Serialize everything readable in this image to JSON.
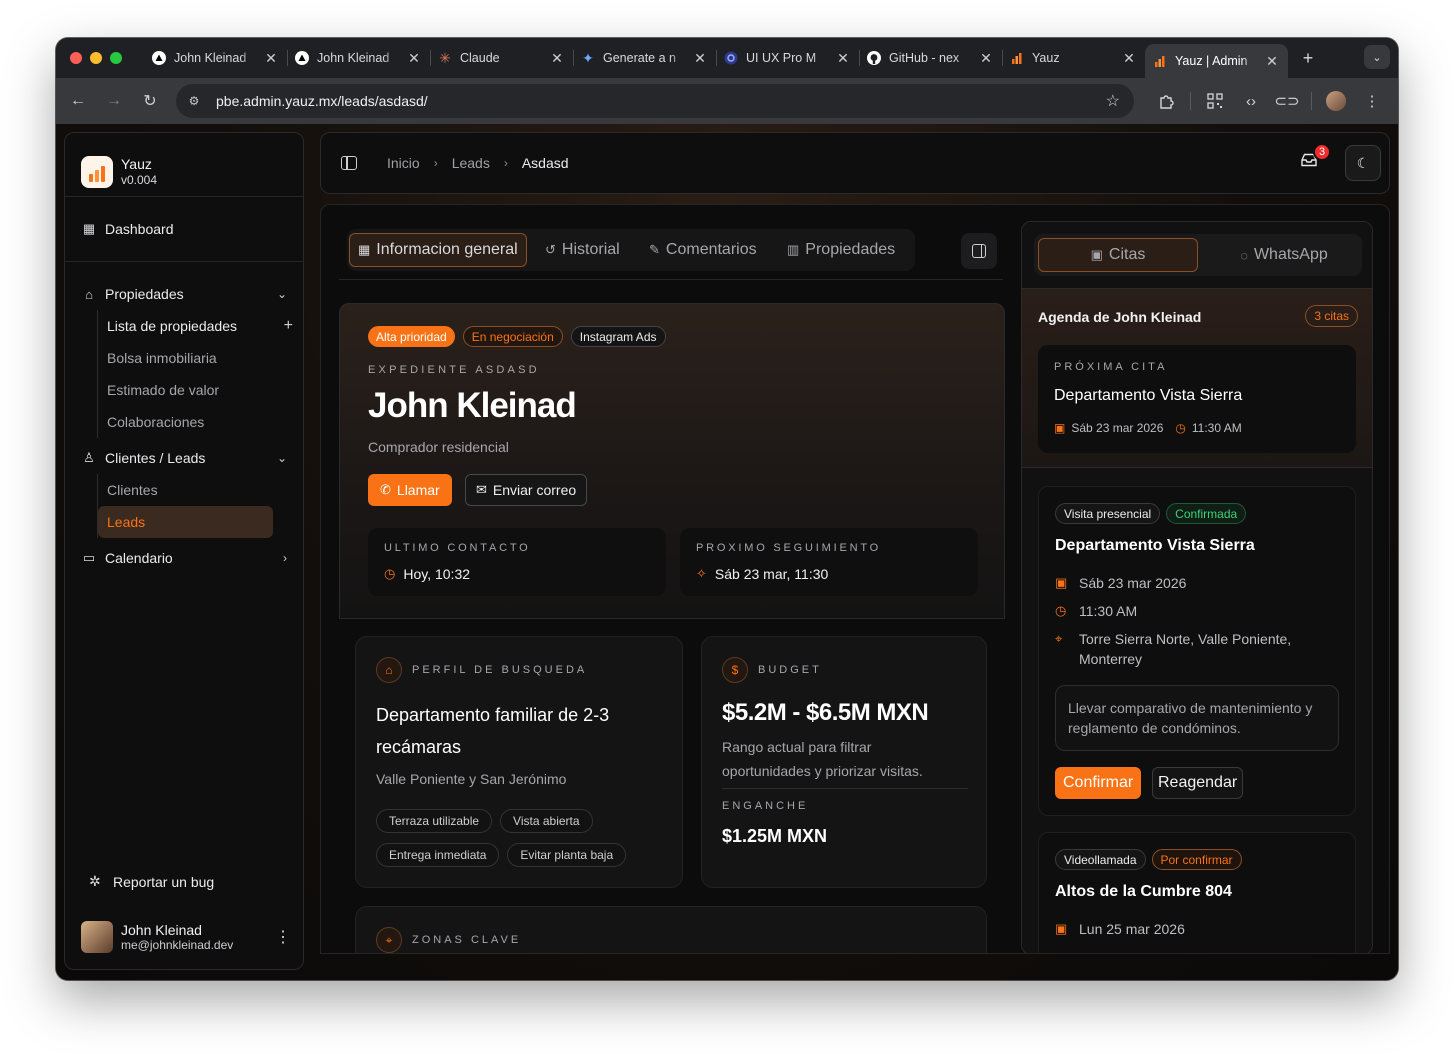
{
  "browser": {
    "tabs": [
      {
        "title": "John Kleinad",
        "icon": "triangle-icon"
      },
      {
        "title": "John Kleinad",
        "icon": "triangle-icon"
      },
      {
        "title": "Claude",
        "icon": "claude-icon"
      },
      {
        "title": "Generate a n",
        "icon": "sparkle-icon"
      },
      {
        "title": "UI UX Pro M",
        "icon": "circle-icon"
      },
      {
        "title": "GitHub - nex",
        "icon": "github-icon"
      },
      {
        "title": "Yauz",
        "icon": "yauz-icon"
      },
      {
        "title": "Yauz | Admin",
        "icon": "yauz-icon"
      }
    ],
    "url": "pbe.admin.yauz.mx/leads/asdasd/"
  },
  "brand": {
    "name": "Yauz",
    "version": "v0.004"
  },
  "sidebar": {
    "dashboard": "Dashboard",
    "propiedades": "Propiedades",
    "propiedades_items": [
      "Lista de propiedades",
      "Bolsa inmobiliaria",
      "Estimado de valor",
      "Colaboraciones"
    ],
    "clientes": "Clientes / Leads",
    "clientes_items": [
      "Clientes",
      "Leads"
    ],
    "calendario": "Calendario",
    "report_bug": "Reportar un bug",
    "user_name": "John Kleinad",
    "user_email": "me@johnkleinad.dev"
  },
  "header": {
    "breadcrumbs": [
      "Inicio",
      "Leads",
      "Asdasd"
    ],
    "notification_count": "3"
  },
  "lead_tabs": [
    "Informacion general",
    "Historial",
    "Comentarios",
    "Propiedades"
  ],
  "lead": {
    "tags": [
      "Alta prioridad",
      "En negociación",
      "Instagram Ads"
    ],
    "expediente": "EXPEDIENTE ASDASD",
    "name": "John Kleinad",
    "role": "Comprador residencial",
    "call_label": "Llamar",
    "email_label": "Enviar correo",
    "last_contact_label": "ULTIMO CONTACTO",
    "last_contact_value": "Hoy, 10:32",
    "next_followup_label": "PROXIMO SEGUIMIENTO",
    "next_followup_value": "Sáb 23 mar, 11:30"
  },
  "search_profile": {
    "label": "PERFIL DE BUSQUEDA",
    "title_line1": "Departamento familiar de 2-3",
    "title_line2": "recámaras",
    "zones": "Valle Poniente y San Jerónimo",
    "pills": [
      "Terraza utilizable",
      "Vista abierta",
      "Entrega inmediata",
      "Evitar planta baja"
    ]
  },
  "budget": {
    "label": "BUDGET",
    "range": "$5.2M - $6.5M MXN",
    "desc_line1": "Rango actual para filtrar",
    "desc_line2": "oportunidades y priorizar visitas.",
    "down_label": "ENGANCHE",
    "down_value": "$1.25M MXN"
  },
  "key_zones": {
    "label": "ZONAS CLAVE"
  },
  "right_tabs": [
    "Citas",
    "WhatsApp"
  ],
  "agenda": {
    "title": "Agenda de John Kleinad",
    "count": "3 citas",
    "next_label": "PRÓXIMA CITA",
    "next_title": "Departamento Vista Sierra",
    "next_date": "Sáb 23 mar 2026",
    "next_time": "11:30 AM"
  },
  "appointments": [
    {
      "type": "Visita presencial",
      "status": "Confirmada",
      "title": "Departamento Vista Sierra",
      "date": "Sáb 23 mar 2026",
      "time": "11:30 AM",
      "location_line1": "Torre Sierra Norte, Valle Poniente,",
      "location_line2": "Monterrey",
      "note_line1": "Llevar comparativo de mantenimiento y",
      "note_line2": "reglamento de condóminos.",
      "confirm_label": "Confirmar",
      "reschedule_label": "Reagendar"
    },
    {
      "type": "Videollamada",
      "status": "Por confirmar",
      "title": "Altos de la Cumbre 804",
      "date": "Lun 25 mar 2026"
    }
  ],
  "colors": {
    "accent": "#f97316",
    "success": "#3fcf75",
    "danger": "#ef2b2b"
  }
}
